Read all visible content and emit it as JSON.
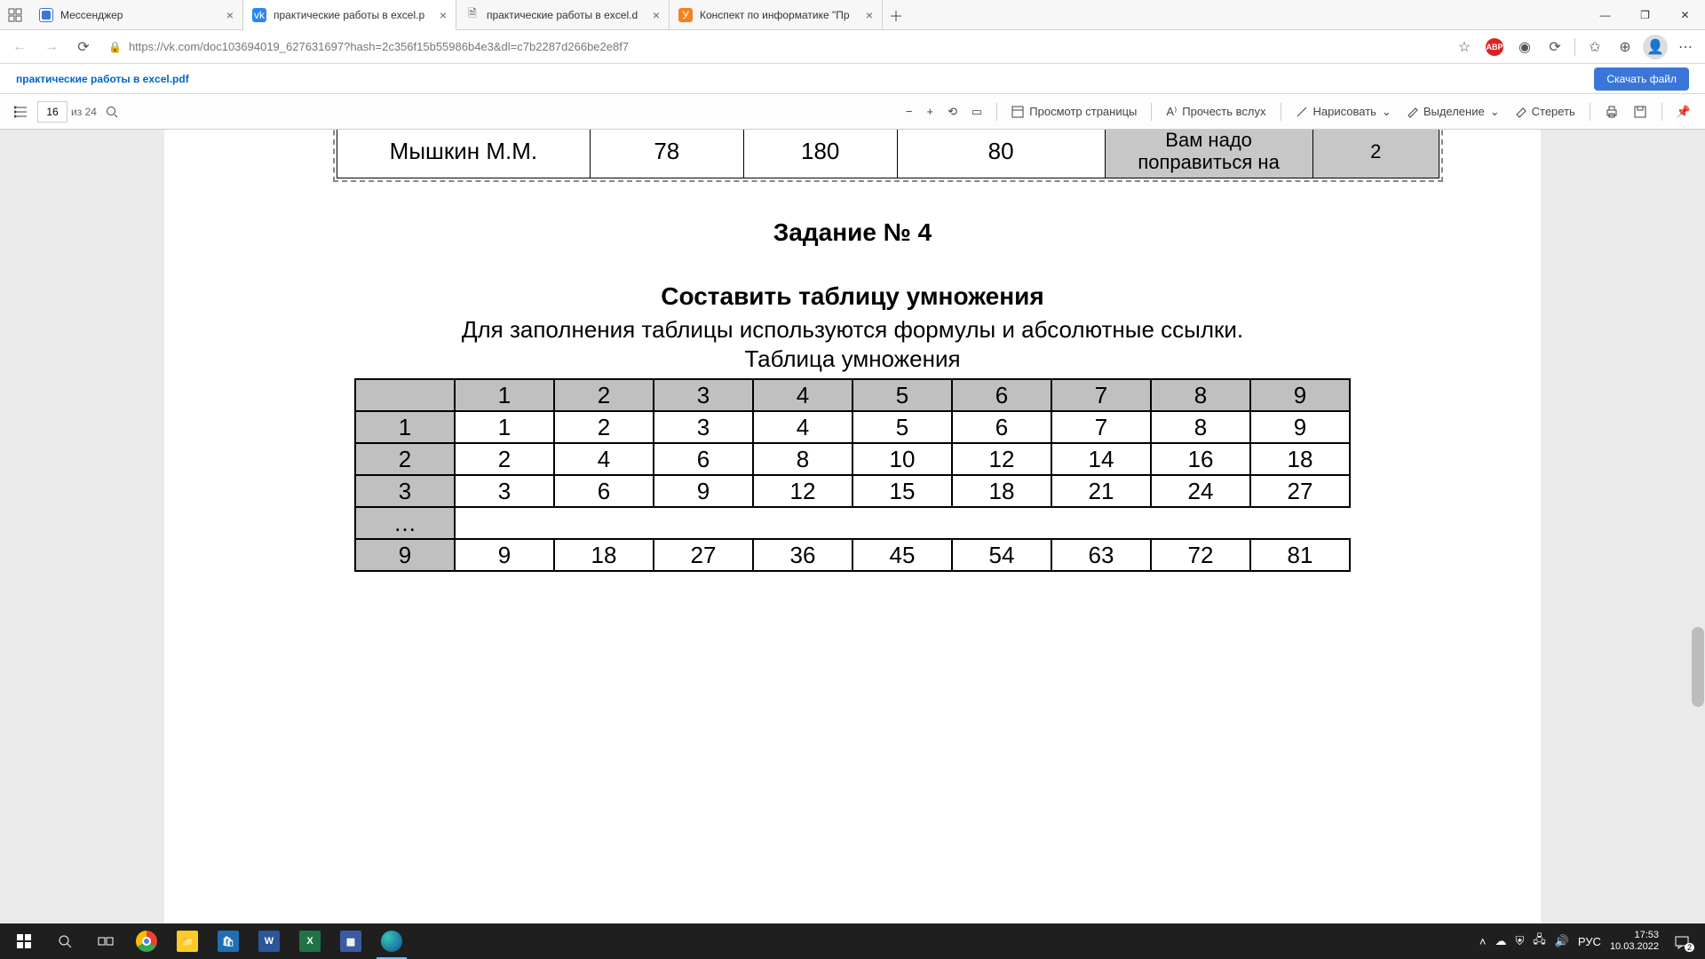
{
  "tabs": [
    {
      "label": "Мессенджер"
    },
    {
      "label": "практические работы в excel.p"
    },
    {
      "label": "практические работы в excel.d"
    },
    {
      "label": "Конспект по информатике \"Пр"
    }
  ],
  "url": "https://vk.com/doc103694019_627631697?hash=2c356f15b55986b4e3&dl=c7b2287d266be2e8f7",
  "infobar": {
    "filename": "практические работы в excel.pdf",
    "download": "Скачать файл"
  },
  "pdf": {
    "page_current": "16",
    "page_total_prefix": "из",
    "page_total": "24",
    "view_label": "Просмотр страницы",
    "read_label": "Прочесть вслух",
    "draw_label": "Нарисовать",
    "highlight_label": "Выделение",
    "erase_label": "Стереть"
  },
  "doc": {
    "top_name": "Мышкин М.М.",
    "top_v1": "78",
    "top_v2": "180",
    "top_v3": "80",
    "top_msg_l1": "Вам надо",
    "top_msg_l2": "поправиться на",
    "top_v4": "2",
    "title": "Задание № 4",
    "subtitle": "Составить таблицу умножения",
    "instruction": "Для заполнения таблицы используются формулы и абсолютные ссылки.",
    "caption": "Таблица умножения",
    "mult_header": [
      "",
      "1",
      "2",
      "3",
      "4",
      "5",
      "6",
      "7",
      "8",
      "9"
    ],
    "mult_rows": [
      [
        "1",
        "1",
        "2",
        "3",
        "4",
        "5",
        "6",
        "7",
        "8",
        "9"
      ],
      [
        "2",
        "2",
        "4",
        "6",
        "8",
        "10",
        "12",
        "14",
        "16",
        "18"
      ],
      [
        "3",
        "3",
        "6",
        "9",
        "12",
        "15",
        "18",
        "21",
        "24",
        "27"
      ]
    ],
    "mult_dots": "…",
    "mult_last": [
      "9",
      "9",
      "18",
      "27",
      "36",
      "45",
      "54",
      "63",
      "72",
      "81"
    ]
  },
  "tray": {
    "lang": "РУС",
    "time": "17:53",
    "date": "10.03.2022",
    "notif_count": "2"
  },
  "abp": "ABP"
}
